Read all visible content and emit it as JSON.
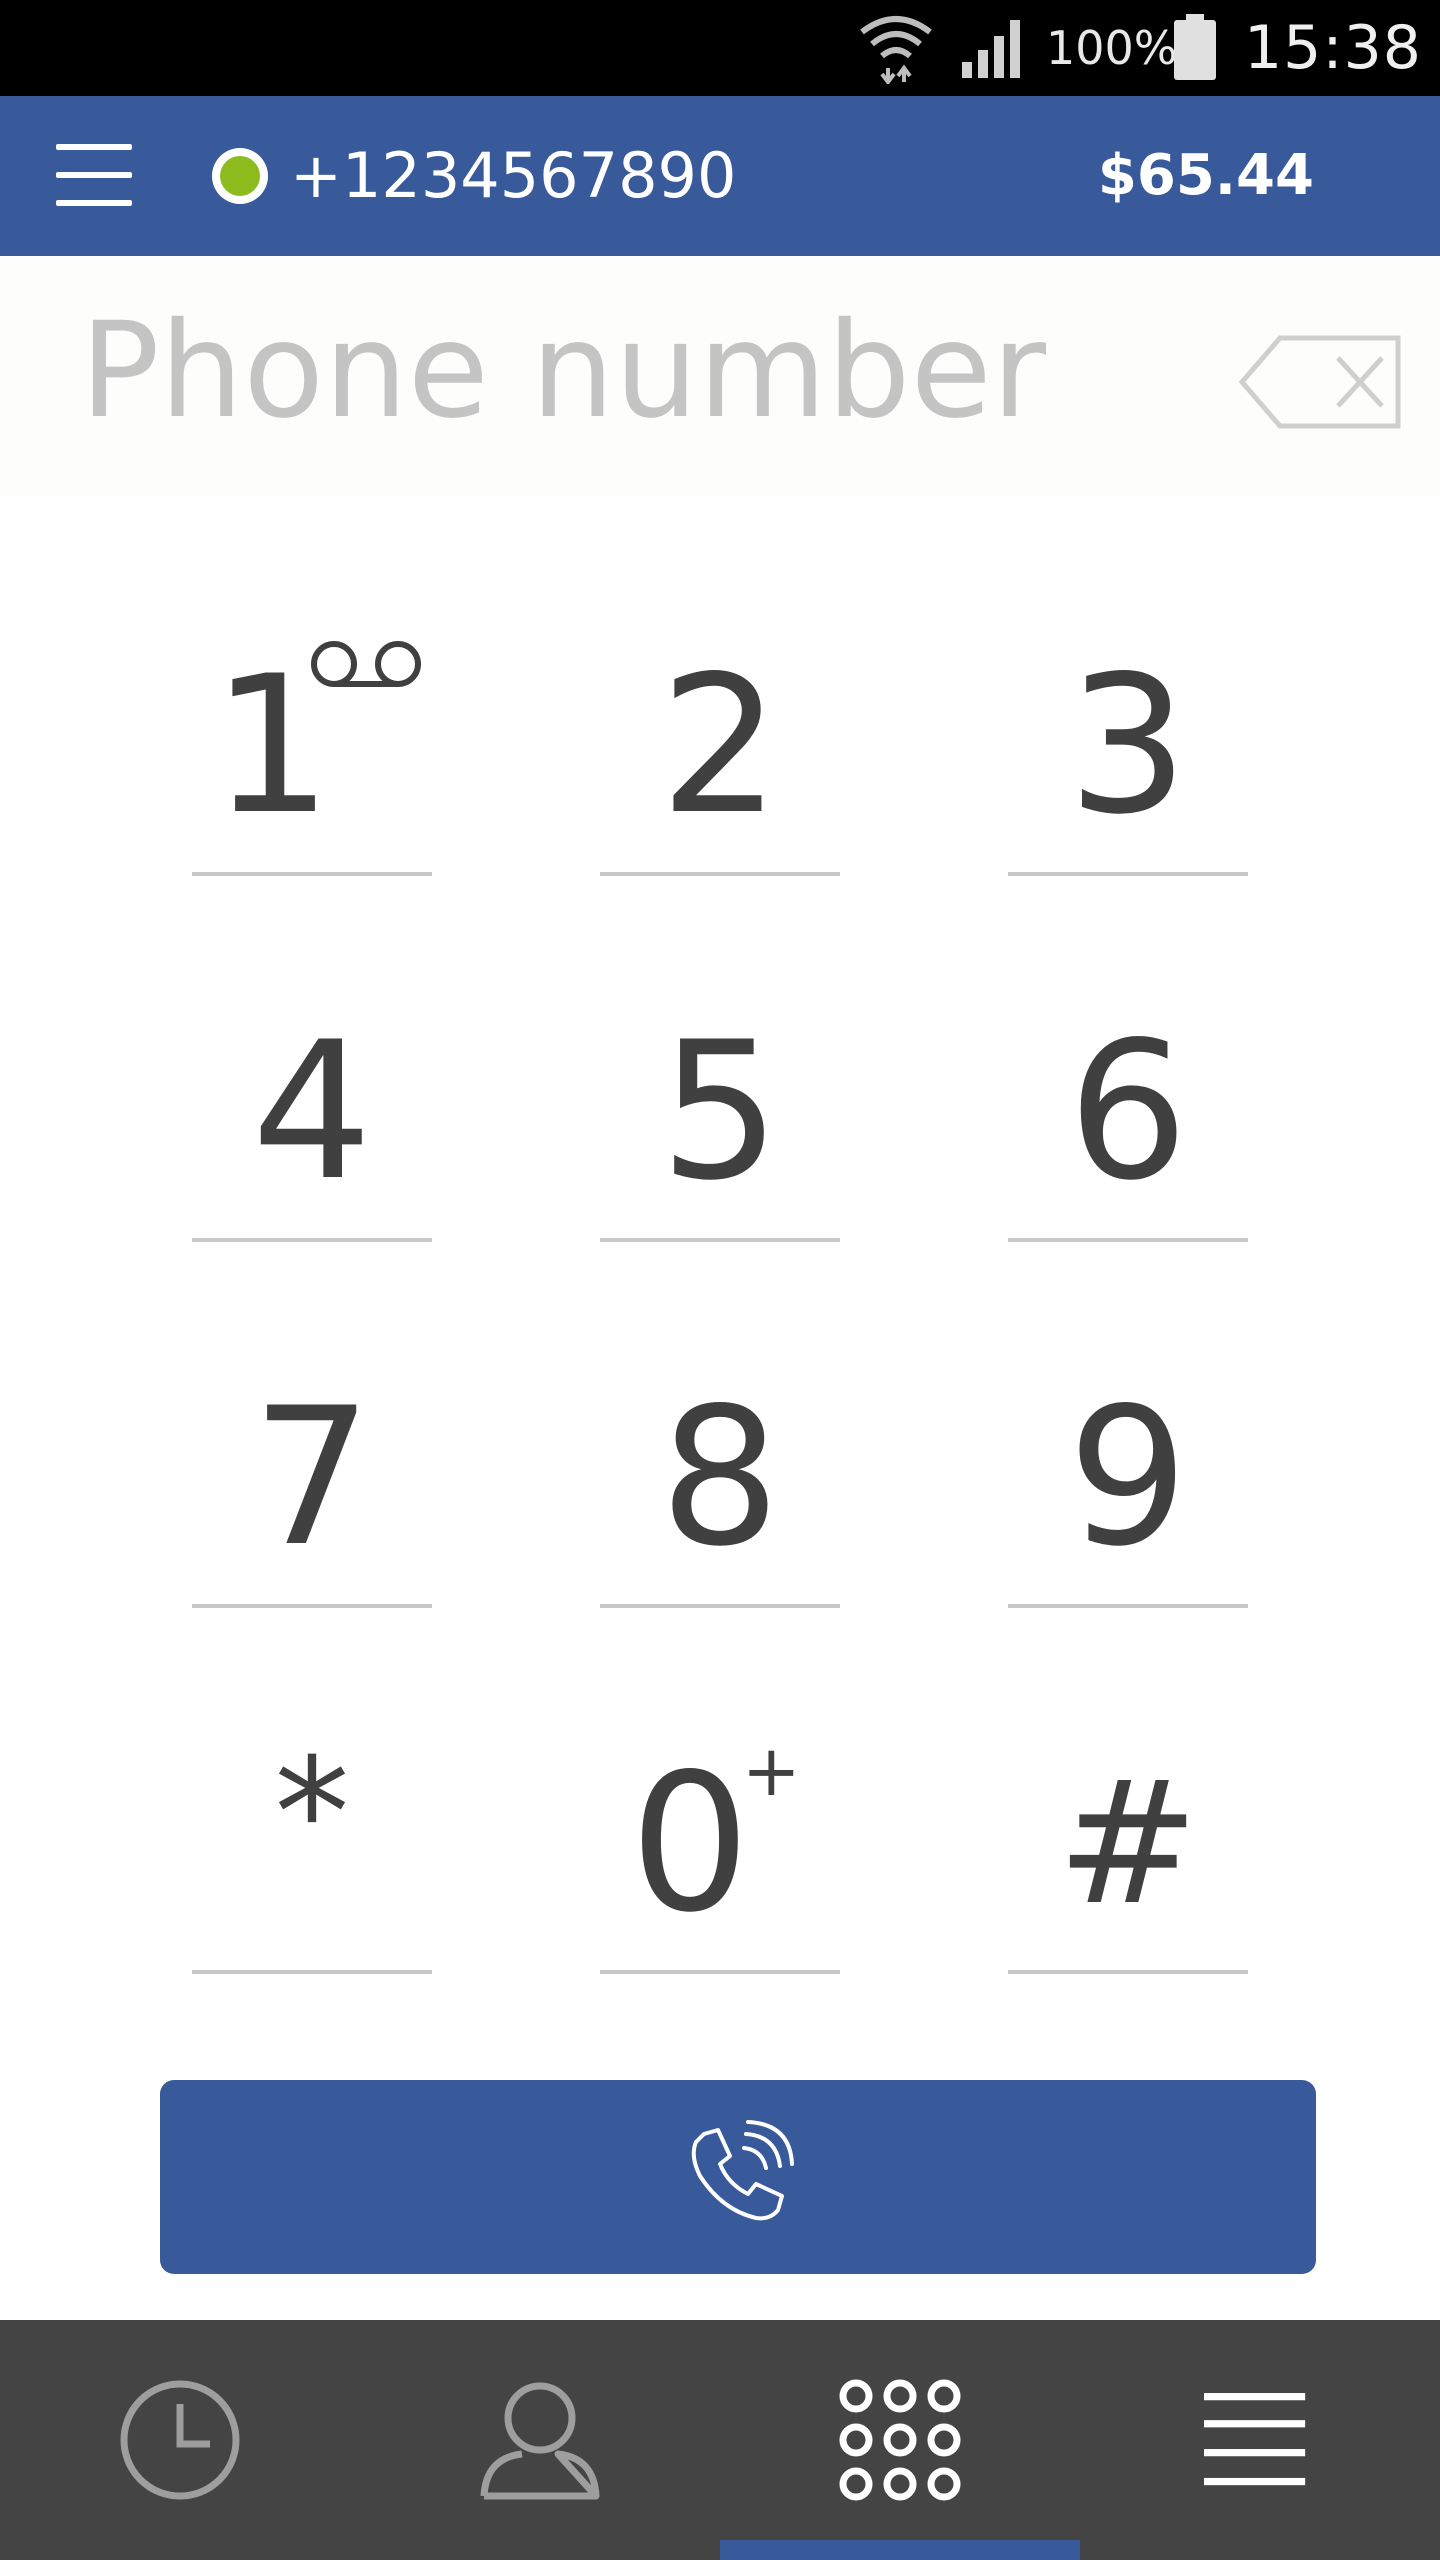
{
  "status_bar": {
    "battery_percent": "100%",
    "time": "15:38",
    "icons": [
      "wifi-icon",
      "cell-signal-icon",
      "battery-icon"
    ]
  },
  "header": {
    "menu_icon": "hamburger-menu-icon",
    "presence_status_color": "#8dbb1e",
    "account_number": "+1234567890",
    "balance": "$65.44"
  },
  "dialer": {
    "number_value": "",
    "number_placeholder": "Phone number",
    "backspace_icon": "backspace-icon"
  },
  "keypad": {
    "keys": [
      {
        "digit": "1",
        "sub": "voicemail-icon"
      },
      {
        "digit": "2",
        "sub": ""
      },
      {
        "digit": "3",
        "sub": ""
      },
      {
        "digit": "4",
        "sub": ""
      },
      {
        "digit": "5",
        "sub": ""
      },
      {
        "digit": "6",
        "sub": ""
      },
      {
        "digit": "7",
        "sub": ""
      },
      {
        "digit": "8",
        "sub": ""
      },
      {
        "digit": "9",
        "sub": ""
      },
      {
        "digit": "*",
        "sub": ""
      },
      {
        "digit": "0",
        "sub": "+"
      },
      {
        "digit": "#",
        "sub": ""
      }
    ]
  },
  "call_button": {
    "icon": "phone-call-icon"
  },
  "bottom_nav": {
    "items": [
      {
        "icon": "clock-history-icon",
        "active": false
      },
      {
        "icon": "contact-person-icon",
        "active": false
      },
      {
        "icon": "dialpad-icon",
        "active": true
      },
      {
        "icon": "hamburger-more-icon",
        "active": false
      }
    ]
  },
  "colors": {
    "brand_blue": "#38599a",
    "nav_background": "#444444",
    "digit_text": "#404040",
    "placeholder": "#c4c4c4"
  }
}
